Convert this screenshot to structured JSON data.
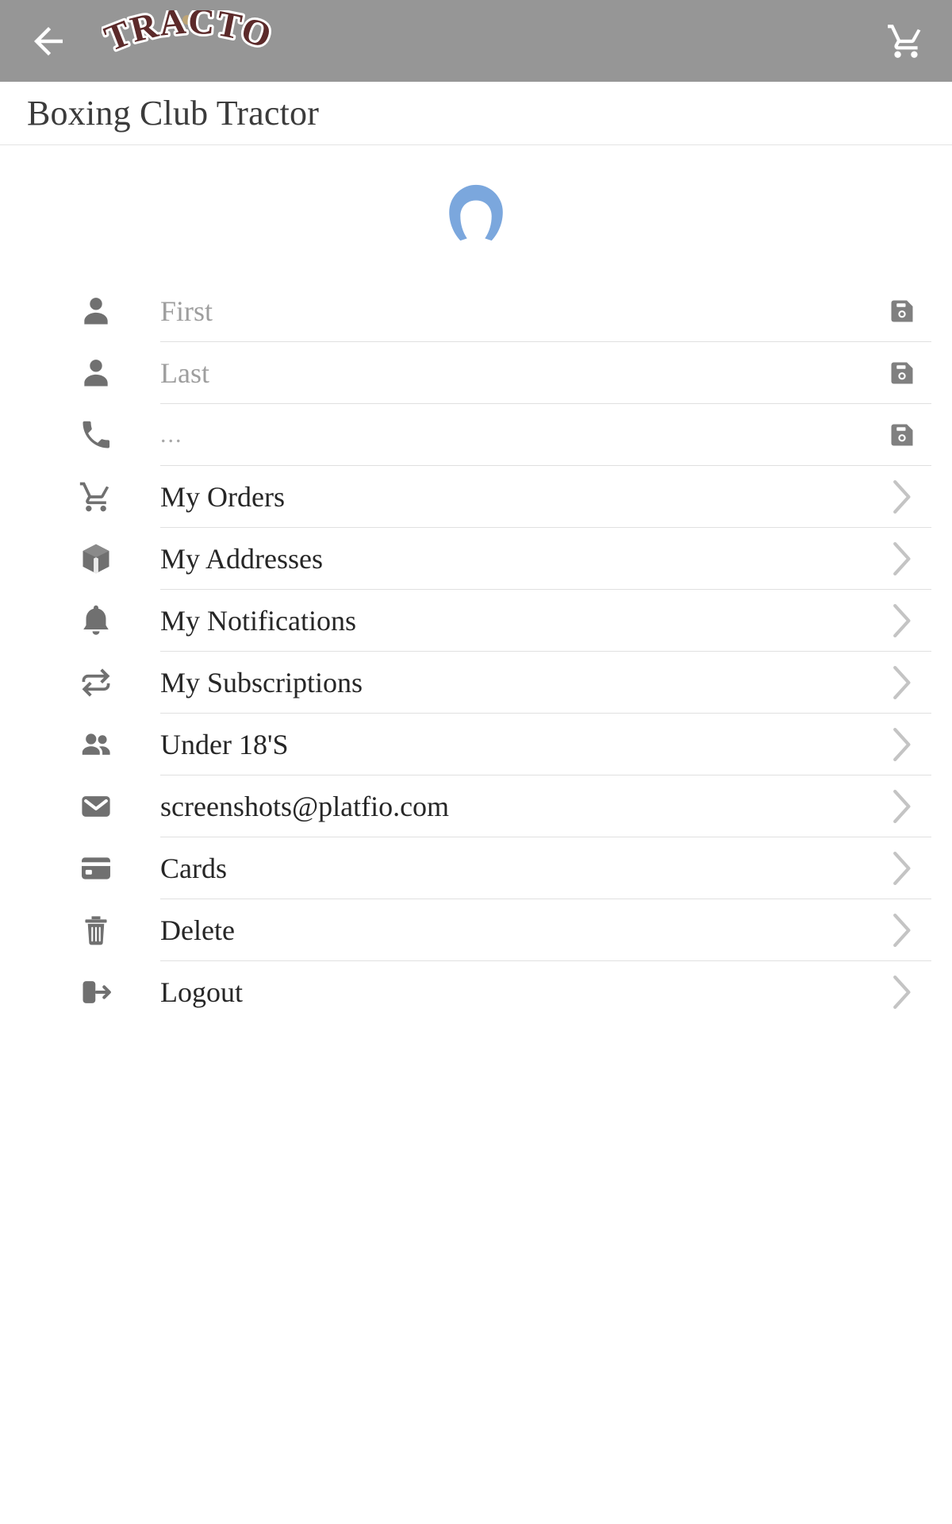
{
  "appbar": {
    "back_icon": "arrow-left-icon",
    "logo_text": "TRACTOR",
    "logo_color": "#5c2a2a",
    "cart_icon": "shopping-cart-icon",
    "background": "#969696"
  },
  "header": {
    "title": "Boxing Club Tractor"
  },
  "profile": {
    "avatar_icon": "person-placeholder-avatar",
    "avatar_color": "#7ba7dd"
  },
  "fields": [
    {
      "name": "first-name",
      "icon": "person-icon",
      "value": "",
      "placeholder": "First",
      "action_icon": "save-icon"
    },
    {
      "name": "last-name",
      "icon": "person-icon",
      "value": "",
      "placeholder": "Last",
      "action_icon": "save-icon"
    },
    {
      "name": "phone",
      "icon": "phone-icon",
      "value": "",
      "placeholder": "...",
      "action_icon": "save-icon"
    }
  ],
  "menu": [
    {
      "name": "my-orders",
      "icon": "shopping-cart-icon",
      "label": "My Orders",
      "trailing": "chevron-right-icon"
    },
    {
      "name": "my-addresses",
      "icon": "box-icon",
      "label": "My Addresses",
      "trailing": "chevron-right-icon"
    },
    {
      "name": "my-notifications",
      "icon": "bell-icon",
      "label": "My Notifications",
      "trailing": "chevron-right-icon"
    },
    {
      "name": "my-subscriptions",
      "icon": "repeat-icon",
      "label": "My Subscriptions",
      "trailing": "chevron-right-icon"
    },
    {
      "name": "under-18s",
      "icon": "people-icon",
      "label": "Under 18'S",
      "trailing": "chevron-right-icon"
    },
    {
      "name": "email",
      "icon": "mail-icon",
      "label": "screenshots@platfio.com",
      "trailing": "chevron-right-icon"
    },
    {
      "name": "cards",
      "icon": "credit-card-icon",
      "label": "Cards",
      "trailing": "chevron-right-icon"
    },
    {
      "name": "delete",
      "icon": "trash-icon",
      "label": "Delete",
      "trailing": "chevron-right-icon"
    },
    {
      "name": "logout",
      "icon": "logout-icon",
      "label": "Logout",
      "trailing": "chevron-right-icon"
    }
  ],
  "colors": {
    "icon_gray": "#707070",
    "divider": "#e0e0e0",
    "text": "#262626",
    "placeholder": "#9e9e9e",
    "chevron": "#c4c4c4"
  }
}
